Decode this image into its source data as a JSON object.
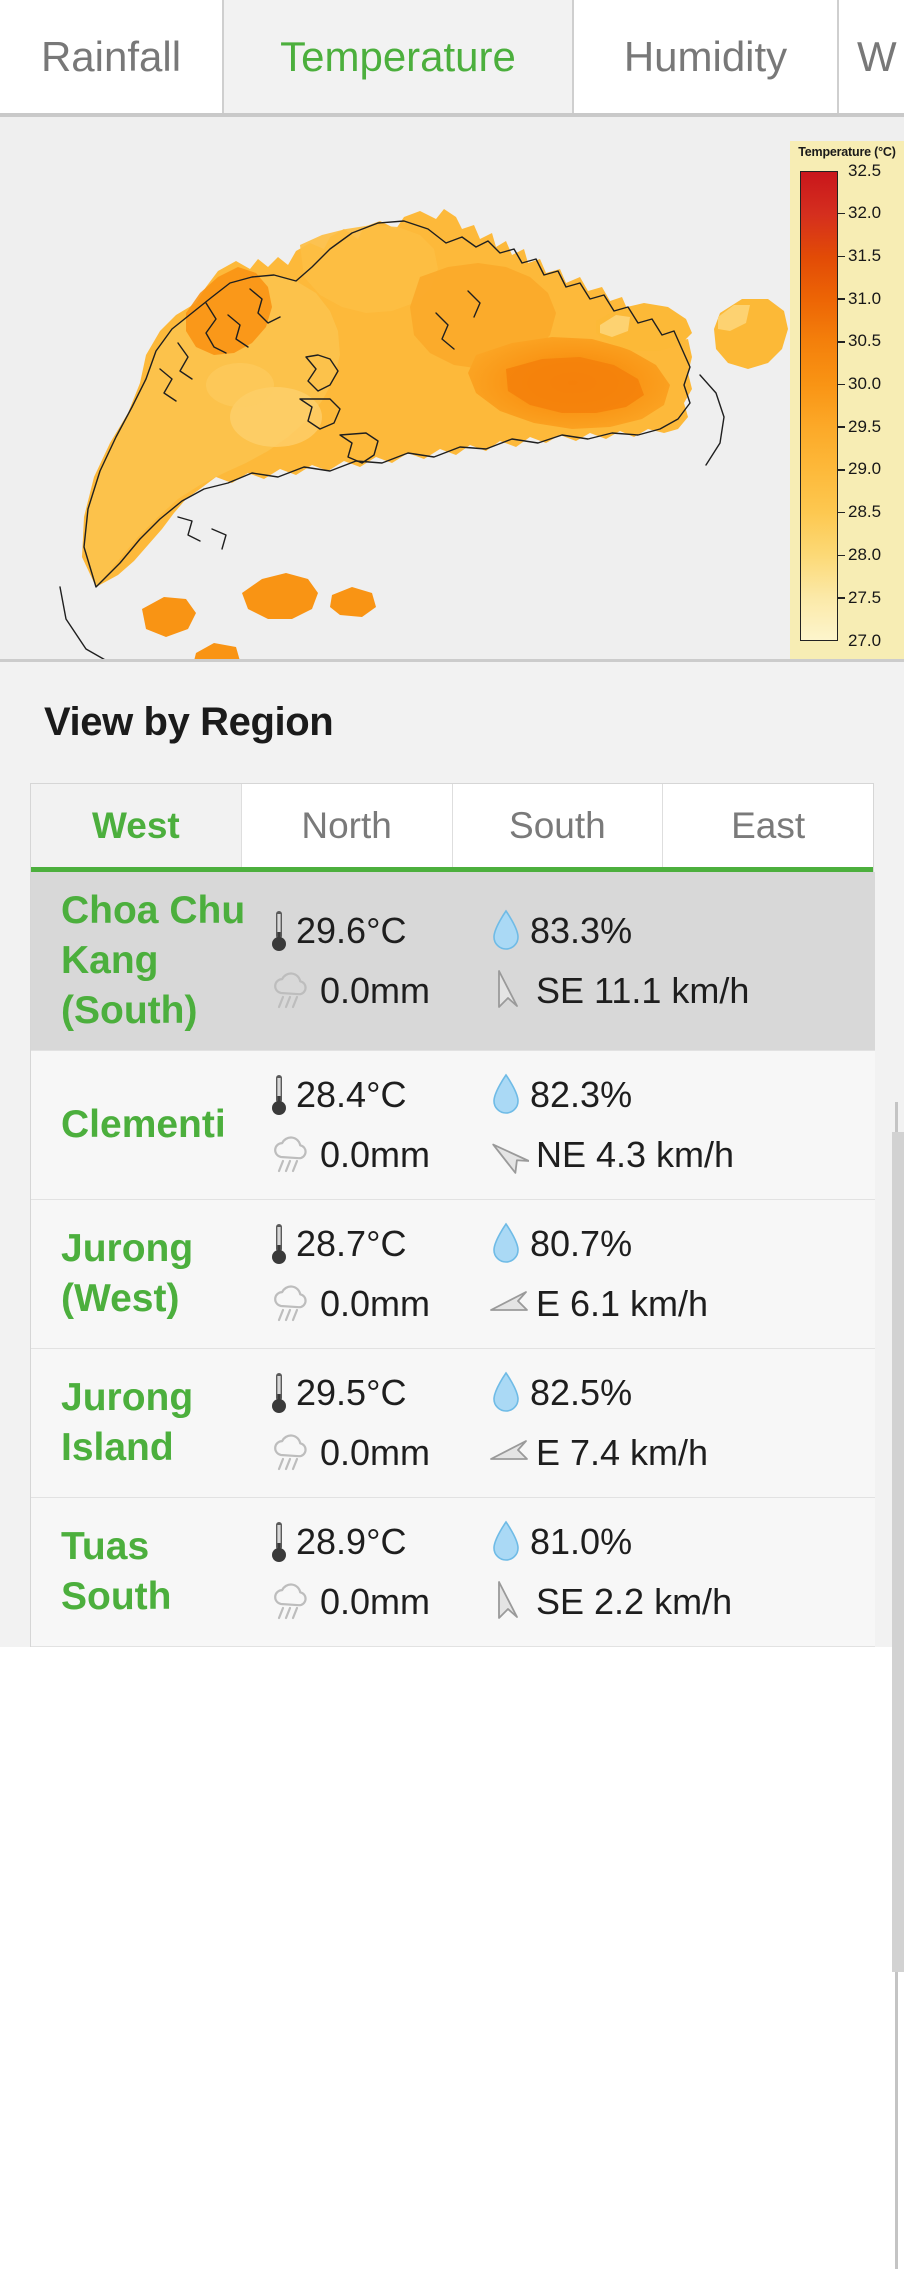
{
  "top_tabs": [
    {
      "label": "Rainfall",
      "active": false
    },
    {
      "label": "Temperature",
      "active": true
    },
    {
      "label": "Humidity",
      "active": false
    },
    {
      "label": "W",
      "active": false
    }
  ],
  "map": {
    "type": "choropleth-heatmap",
    "subject": "Singapore",
    "background_color": "#efefef",
    "legend": {
      "title": "Temperature (°C)",
      "background_color": "#f7edb4",
      "ticks": [
        "32.5",
        "32.0",
        "31.5",
        "31.0",
        "30.5",
        "30.0",
        "29.5",
        "29.0",
        "28.5",
        "28.0",
        "27.5",
        "27.0"
      ],
      "min": 27.0,
      "max": 32.5,
      "step": 0.5,
      "colors_low_to_high": [
        "#fdf5cc",
        "#fbe9a8",
        "#fcd976",
        "#fdc850",
        "#fdb93a",
        "#fca928",
        "#f99414",
        "#f4800b",
        "#ed6505",
        "#e24b06",
        "#d52f1e",
        "#c9161c"
      ]
    }
  },
  "region_section": {
    "heading": "View by Region",
    "tabs": [
      {
        "label": "West",
        "active": true
      },
      {
        "label": "North",
        "active": false
      },
      {
        "label": "South",
        "active": false
      },
      {
        "label": "East",
        "active": false
      }
    ],
    "accent_color": "#4caf3d"
  },
  "stations": [
    {
      "name": "Choa Chu Kang (South)",
      "temperature": "29.6°C",
      "rainfall": "0.0mm",
      "humidity": "83.3%",
      "wind": "SE 11.1 km/h",
      "wind_direction": "SE",
      "selected": true
    },
    {
      "name": "Clementi",
      "temperature": "28.4°C",
      "rainfall": "0.0mm",
      "humidity": "82.3%",
      "wind": "NE 4.3 km/h",
      "wind_direction": "NE",
      "selected": false
    },
    {
      "name": "Jurong (West)",
      "temperature": "28.7°C",
      "rainfall": "0.0mm",
      "humidity": "80.7%",
      "wind": "E 6.1 km/h",
      "wind_direction": "E",
      "selected": false
    },
    {
      "name": "Jurong Island",
      "temperature": "29.5°C",
      "rainfall": "0.0mm",
      "humidity": "82.5%",
      "wind": "E 7.4 km/h",
      "wind_direction": "E",
      "selected": false
    },
    {
      "name": "Tuas South",
      "temperature": "28.9°C",
      "rainfall": "0.0mm",
      "humidity": "81.0%",
      "wind": "SE 2.2 km/h",
      "wind_direction": "SE",
      "selected": false
    }
  ],
  "icons": {
    "temperature": "thermometer-icon",
    "rainfall": "rain-cloud-icon",
    "humidity": "water-drop-icon",
    "wind": "wind-arrow-icon"
  }
}
